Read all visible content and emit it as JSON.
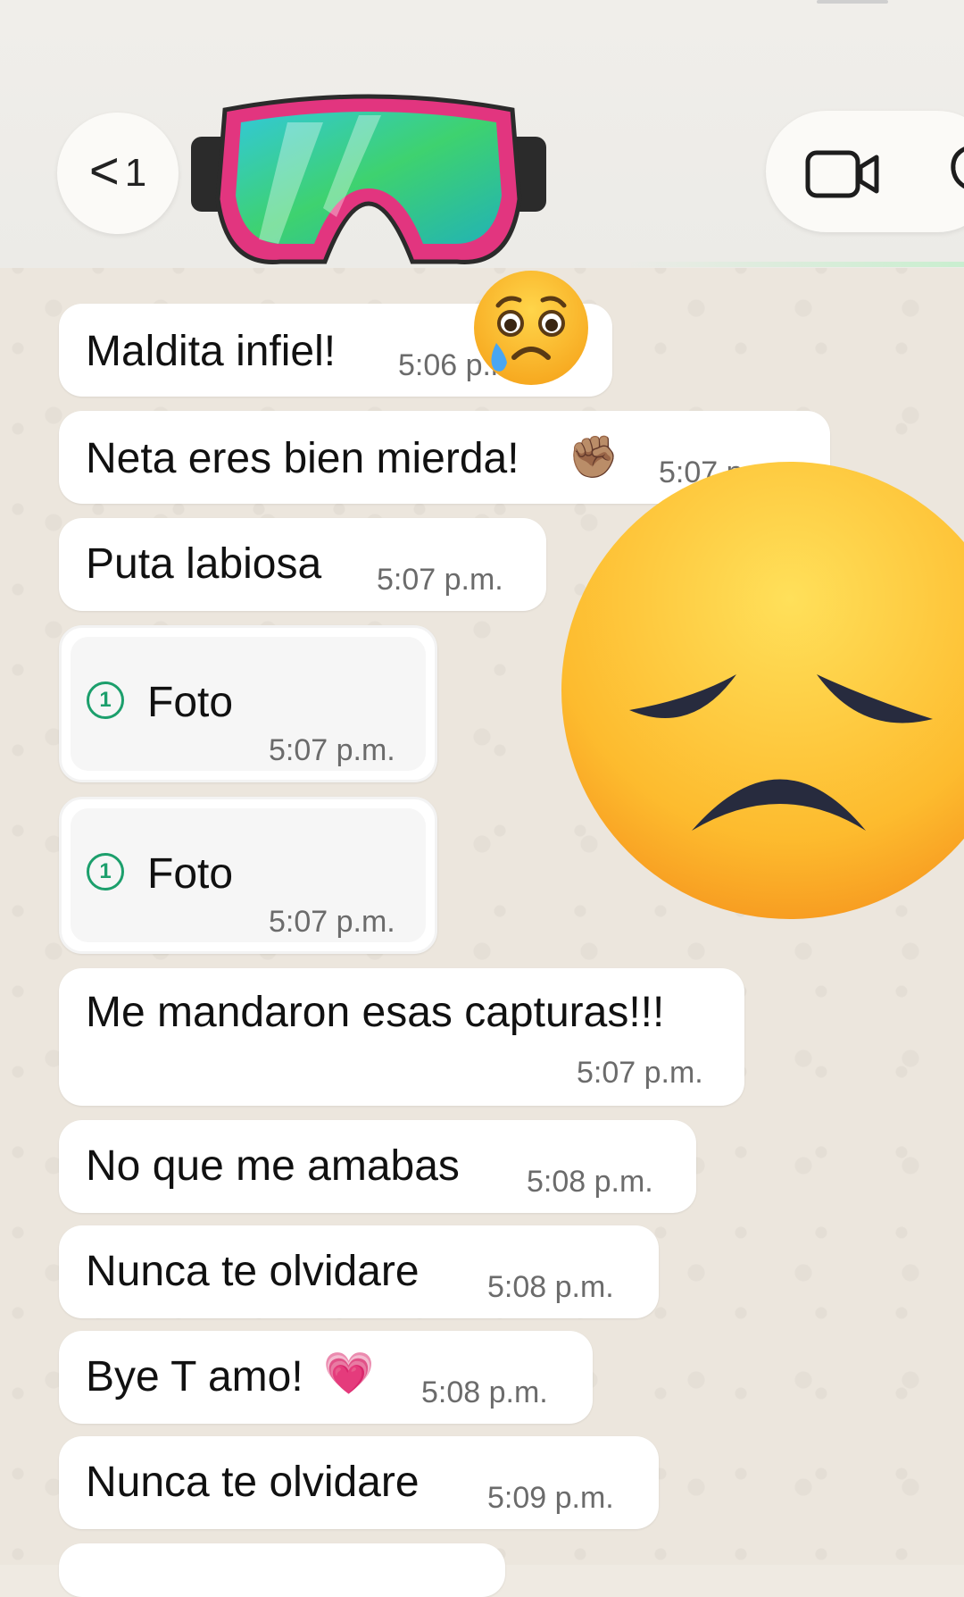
{
  "header": {
    "back_label": "<",
    "unread_count": "1",
    "icons": [
      "goggles-emoji-avatar",
      "video-call-icon",
      "phone-call-icon"
    ]
  },
  "messages": [
    {
      "text": "Maldita infiel!",
      "time": "5:06 p.m."
    },
    {
      "text": "Neta eres bien mierda!",
      "time": "5:07 p.m.",
      "emoji": "✊🏽"
    },
    {
      "text": "Puta labiosa",
      "time": "5:07 p.m."
    },
    {
      "text": "Foto",
      "time": "5:07 p.m.",
      "type": "view-once-photo",
      "badge": "1"
    },
    {
      "text": "Foto",
      "time": "5:07 p.m.",
      "type": "view-once-photo",
      "badge": "1"
    },
    {
      "text": "Me mandaron esas capturas!!!",
      "time": "5:07 p.m."
    },
    {
      "text": "No que me amabas",
      "time": "5:08 p.m."
    },
    {
      "text": "Nunca te olvidare",
      "time": "5:08 p.m."
    },
    {
      "text": "Bye T amo!",
      "time": "5:08 p.m.",
      "emoji": "💗"
    },
    {
      "text": "Nunca te olvidare",
      "time": "5:09 p.m."
    }
  ],
  "overlays": [
    "crying-face-sticker",
    "disappointed-face-sticker"
  ],
  "colors": {
    "background": "#efeae2",
    "bubble": "#ffffff",
    "accent_green": "#1c9f6c",
    "time_text": "#6b6b6b"
  }
}
